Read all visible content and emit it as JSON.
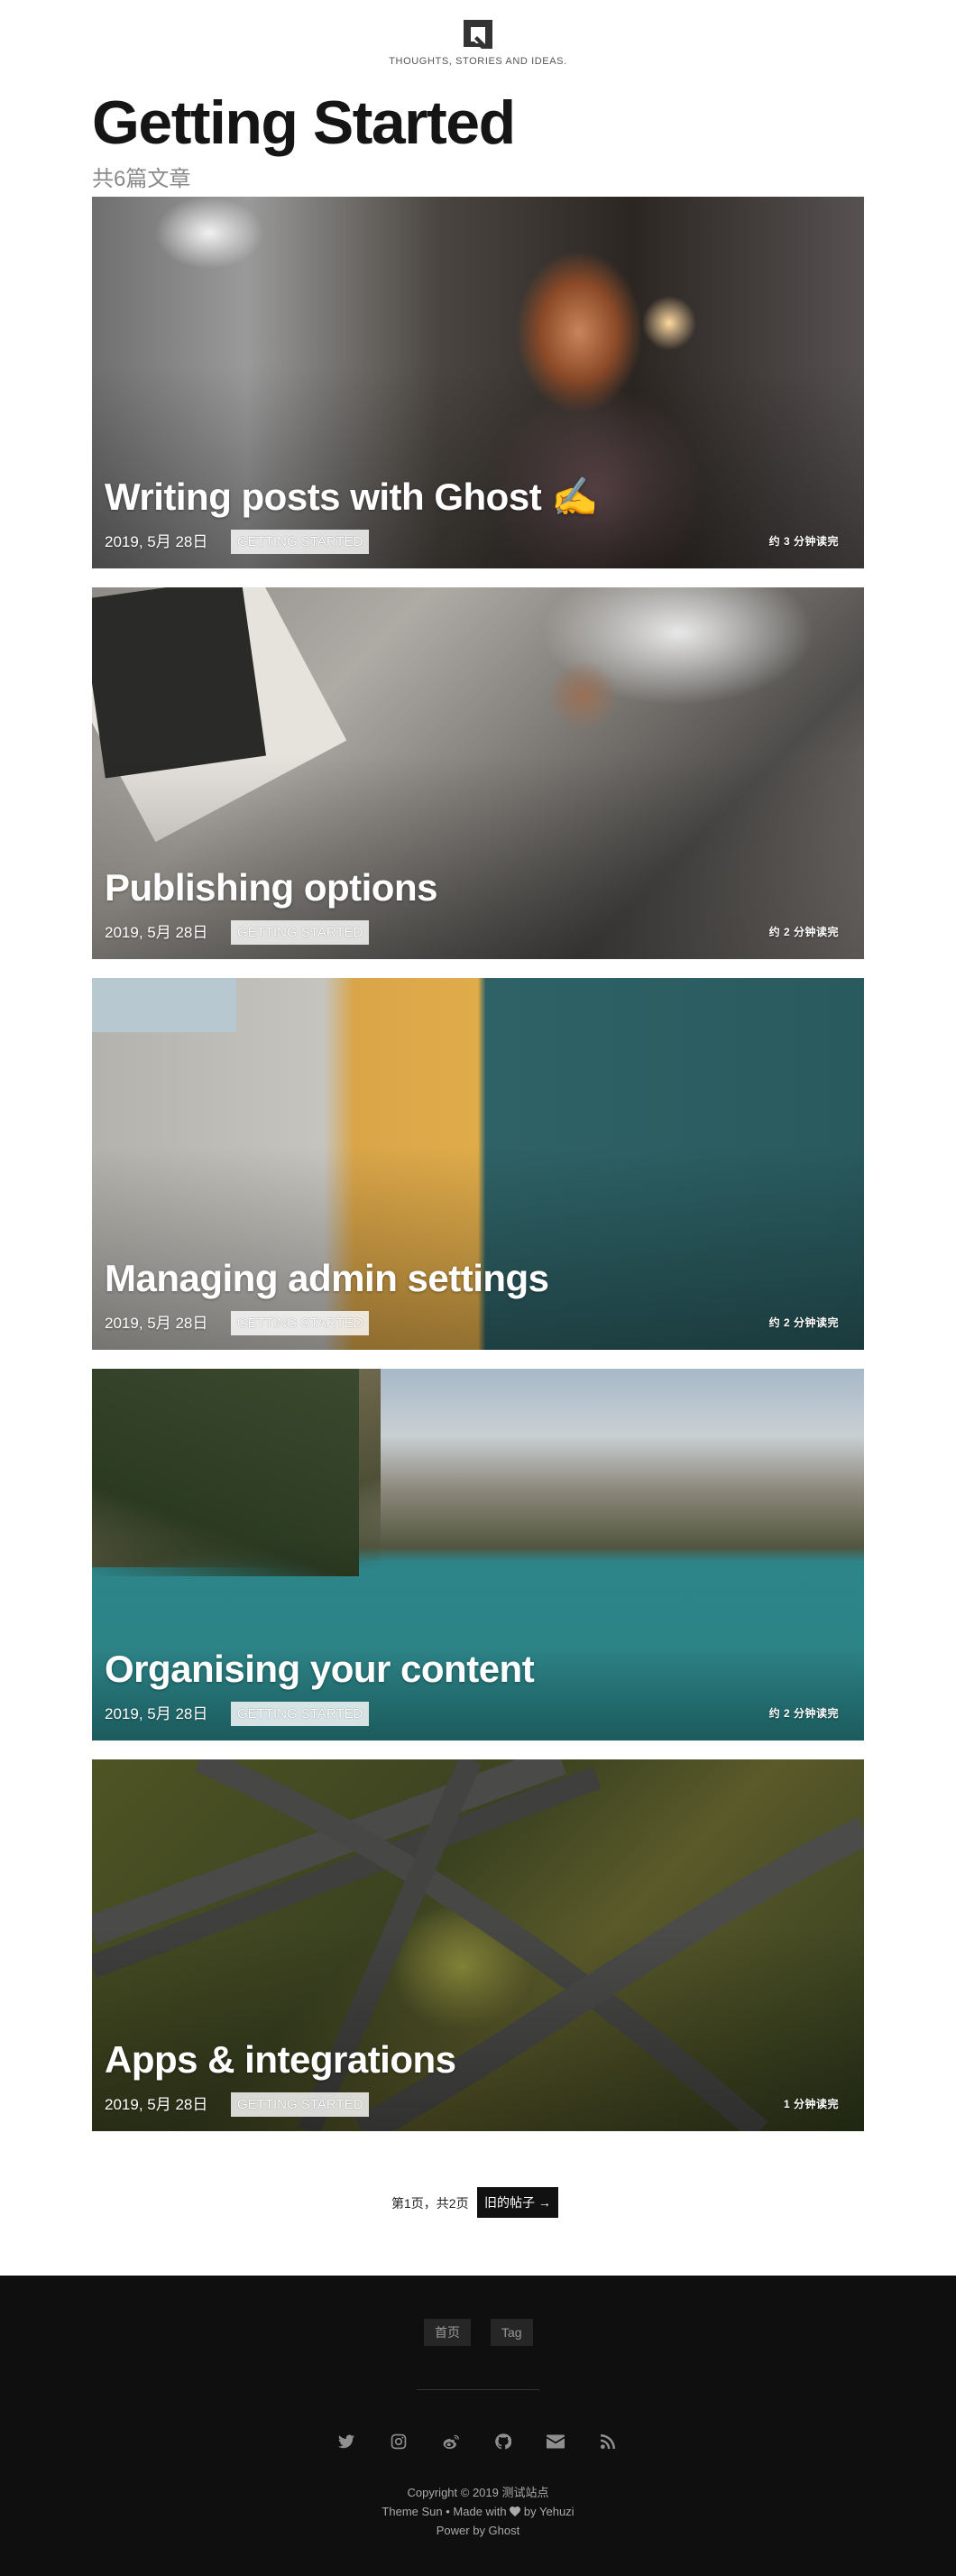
{
  "header": {
    "logo_icon": "blog-logo-icon",
    "tagline": "THOUGHTS, STORIES AND IDEAS."
  },
  "page": {
    "title": "Getting Started",
    "count_text": "共6篇文章"
  },
  "posts": [
    {
      "title": "Writing posts with Ghost ✍️",
      "date": "2019, 5月 28日",
      "tag": "GETTING STARTED",
      "read_time": "约 3 分钟读完"
    },
    {
      "title": "Publishing options",
      "date": "2019, 5月 28日",
      "tag": "GETTING STARTED",
      "read_time": "约 2 分钟读完"
    },
    {
      "title": "Managing admin settings",
      "date": "2019, 5月 28日",
      "tag": "GETTING STARTED",
      "read_time": "约 2 分钟读完"
    },
    {
      "title": "Organising your content",
      "date": "2019, 5月 28日",
      "tag": "GETTING STARTED",
      "read_time": "约 2 分钟读完"
    },
    {
      "title": "Apps & integrations",
      "date": "2019, 5月 28日",
      "tag": "GETTING STARTED",
      "read_time": "1 分钟读完"
    }
  ],
  "pagination": {
    "info": "第1页，共2页",
    "older_label": "旧的帖子 →"
  },
  "footer": {
    "nav": [
      "首页",
      "Tag"
    ],
    "social_icons": [
      "twitter-icon",
      "instagram-icon",
      "weibo-icon",
      "github-icon",
      "email-icon",
      "rss-icon"
    ],
    "copyright": "Copyright © 2019 测试站点",
    "theme_prefix": "Theme Sun • Made with",
    "theme_suffix": "by Yehuzi",
    "powered": "Power by Ghost"
  },
  "colors": {
    "footer_bg": "#0f0f0f",
    "text_dark": "#151515",
    "muted": "#8a8a8a"
  }
}
